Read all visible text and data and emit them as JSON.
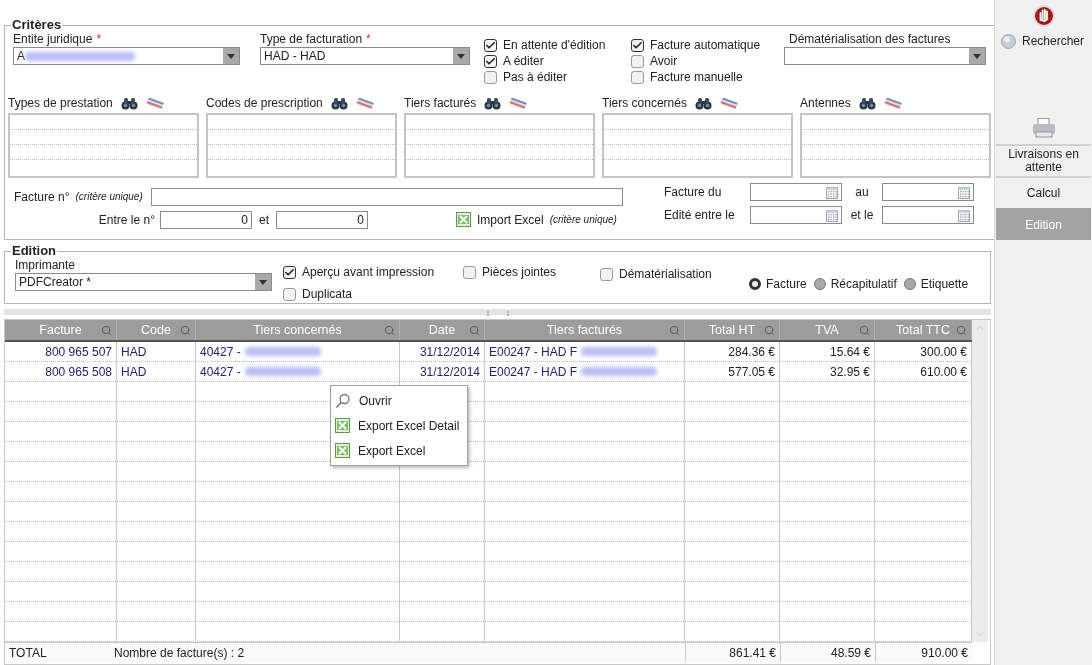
{
  "criteria": {
    "title": "Critères",
    "entite": {
      "label": "Entite juridique",
      "required": "*",
      "value": "A",
      "blurred": true
    },
    "type_facturation": {
      "label": "Type de facturation",
      "required": "*",
      "value": "HAD - HAD"
    },
    "status_checks": [
      {
        "label": "En attente d'édition",
        "checked": true
      },
      {
        "label": "A éditer",
        "checked": true
      },
      {
        "label": "Pas à éditer",
        "checked": false
      }
    ],
    "kind_checks": [
      {
        "label": "Facture automatique",
        "checked": true
      },
      {
        "label": "Avoir",
        "checked": false
      },
      {
        "label": "Facture manuelle",
        "checked": false
      }
    ],
    "dematerialisation": {
      "label": "Dématérialisation des factures"
    },
    "lists": [
      {
        "label": "Types de prestation"
      },
      {
        "label": "Codes de prescription"
      },
      {
        "label": "Tiers facturés"
      },
      {
        "label": "Tiers concernés"
      },
      {
        "label": "Antennes"
      }
    ],
    "facture_no": {
      "label": "Facture n°",
      "hint": "(critère unique)"
    },
    "range": {
      "label": "Entre le n°",
      "from": "0",
      "separator": "et",
      "to": "0"
    },
    "import": {
      "label": "Import Excel",
      "hint": "(critère unique)"
    },
    "dates": [
      {
        "label": "Facture du",
        "separator": "au"
      },
      {
        "label": "Edité entre le",
        "separator": "et le"
      }
    ]
  },
  "edition": {
    "title": "Edition",
    "printer": {
      "label": "Imprimante",
      "value": "PDFCreator *"
    },
    "checks": [
      {
        "label": "Aperçu avant impression",
        "checked": true
      },
      {
        "label": "Duplicata",
        "checked": false
      },
      {
        "label": "Pièces jointes",
        "checked": false
      },
      {
        "label": "Dématérialisation",
        "checked": false
      }
    ],
    "documents": [
      {
        "label": "Facture",
        "selected": true
      },
      {
        "label": "Récapitulatif",
        "selected": false
      },
      {
        "label": "Etiquette",
        "selected": false
      }
    ]
  },
  "table": {
    "columns": [
      "Facture",
      "Code",
      "Tiers concernés",
      "Date",
      "Tiers facturés",
      "Total HT",
      "TVA",
      "Total TTC"
    ],
    "rows": [
      {
        "cells": [
          {
            "text": "800 965 507",
            "blurred": false
          },
          {
            "text": "HAD",
            "blurred": false
          },
          {
            "text": "40427 -",
            "blurred": true
          },
          {
            "text": "31/12/2014",
            "blurred": false
          },
          {
            "text": "E00247 - HAD F",
            "blurred": true
          },
          {
            "text": "284.36 €",
            "blurred": false
          },
          {
            "text": "15.64 €",
            "blurred": false
          },
          {
            "text": "300.00 €",
            "blurred": false
          }
        ]
      },
      {
        "cells": [
          {
            "text": "800 965 508",
            "blurred": false
          },
          {
            "text": "HAD",
            "blurred": false
          },
          {
            "text": "40427 -",
            "blurred": true
          },
          {
            "text": "31/12/2014",
            "blurred": false
          },
          {
            "text": "E00247 - HAD F",
            "blurred": true
          },
          {
            "text": "577.05 €",
            "blurred": false
          },
          {
            "text": "32.95 €",
            "blurred": false
          },
          {
            "text": "610.00 €",
            "blurred": false
          }
        ]
      }
    ],
    "totals": {
      "label": "TOTAL",
      "count": "Nombre de facture(s) : 2",
      "values": [
        "861.41 €",
        "48.59 €",
        "910.00 €"
      ]
    }
  },
  "context_menu": {
    "items": [
      {
        "label": "Ouvrir",
        "kind": "open"
      },
      {
        "label": "Export Excel Detail",
        "kind": "excel"
      },
      {
        "label": "Export Excel",
        "kind": "excel"
      }
    ]
  },
  "sidebar": {
    "search": "Rechercher",
    "tabs": [
      {
        "label": "Livraisons en attente",
        "selected": false
      },
      {
        "label": "Calcul",
        "selected": false
      },
      {
        "label": "Edition",
        "selected": true
      }
    ]
  }
}
